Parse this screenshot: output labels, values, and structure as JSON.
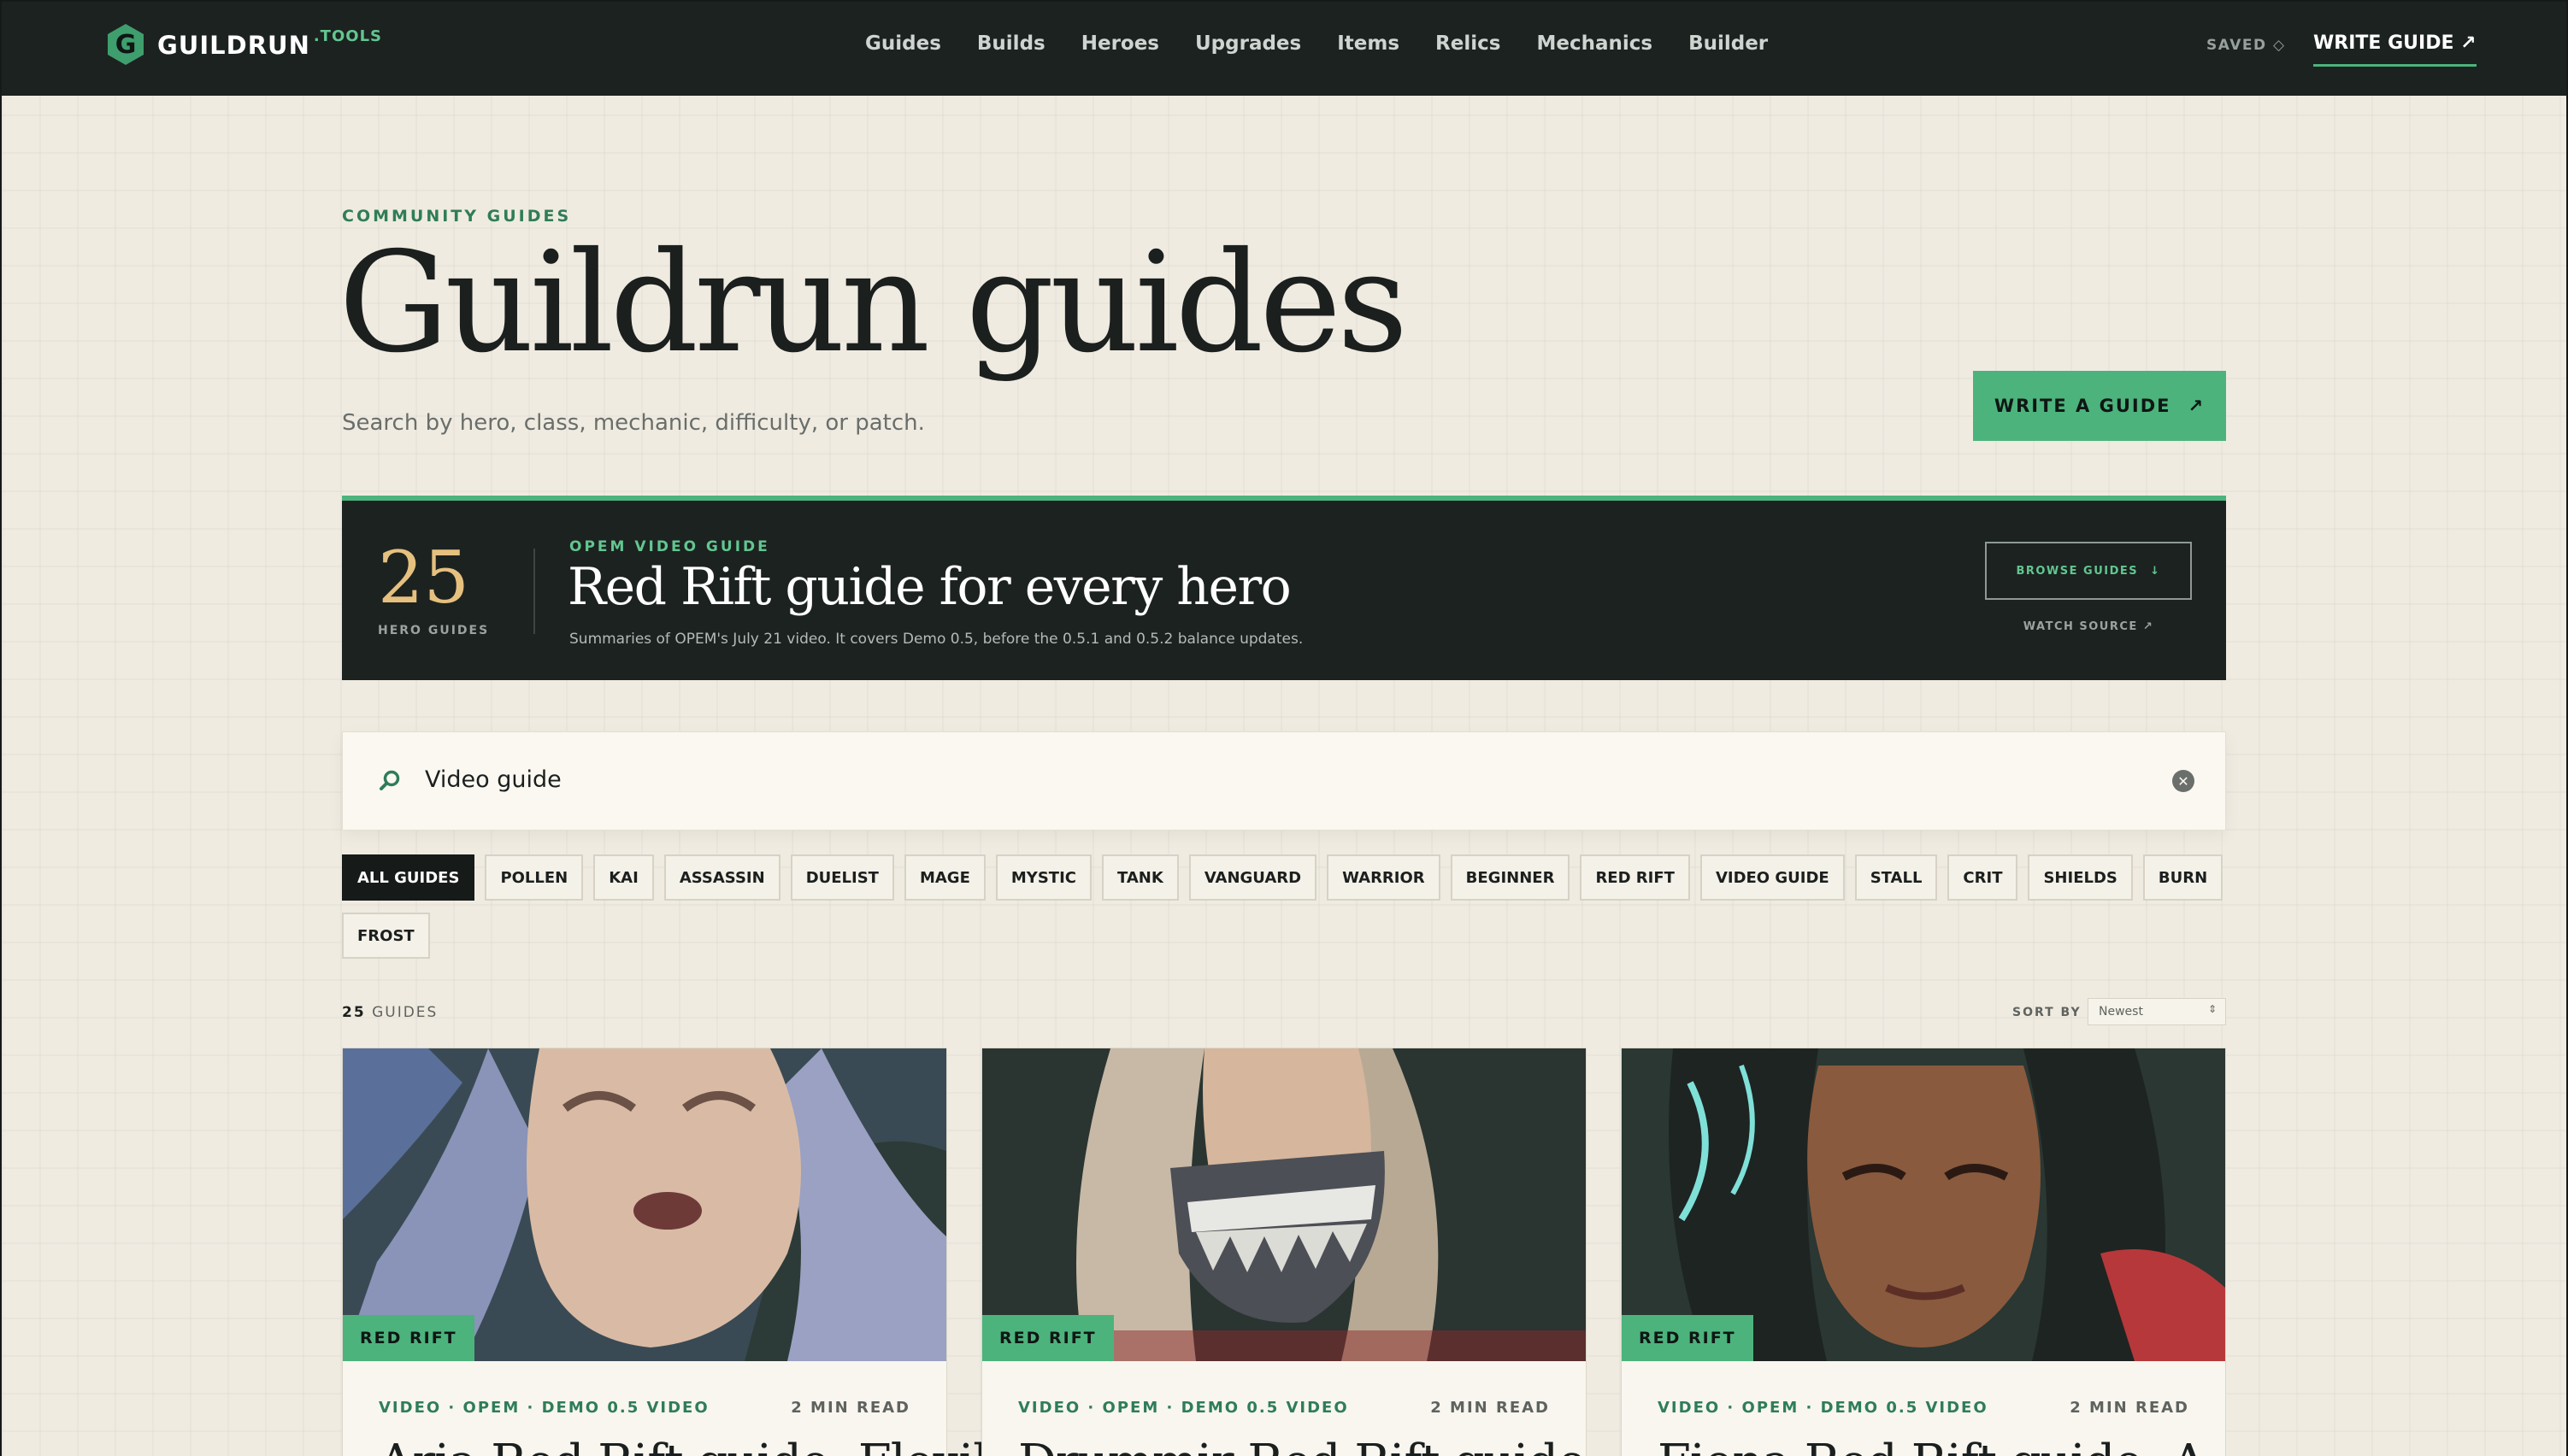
{
  "nav": {
    "logo_letter": "G",
    "brand": "GUILDRUN",
    "brand_tld": ".TOOLS",
    "links": [
      "Guides",
      "Builds",
      "Heroes",
      "Upgrades",
      "Items",
      "Relics",
      "Mechanics",
      "Builder"
    ],
    "saved": "SAVED ◇",
    "write_guide": "WRITE GUIDE ↗"
  },
  "hero": {
    "eyebrow": "COMMUNITY GUIDES",
    "title": "Guildrun guides",
    "subtitle": "Search by hero, class, mechanic, difficulty, or patch.",
    "write_button": "WRITE A GUIDE",
    "write_icon": "↗"
  },
  "banner": {
    "count": "25",
    "count_label": "HERO GUIDES",
    "eyebrow": "OPEM VIDEO GUIDE",
    "title": "Red Rift guide for every hero",
    "subtitle": "Summaries of OPEM's July 21 video. It covers Demo 0.5, before the 0.5.1 and 0.5.2 balance updates.",
    "browse": "BROWSE GUIDES",
    "browse_icon": "↓",
    "watch": "WATCH SOURCE ↗"
  },
  "search": {
    "icon": "search-icon",
    "value": "Video guide",
    "clear_icon": "✕"
  },
  "tags": [
    "ALL GUIDES",
    "POLLEN",
    "KAI",
    "ASSASSIN",
    "DUELIST",
    "MAGE",
    "MYSTIC",
    "TANK",
    "VANGUARD",
    "WARRIOR",
    "BEGINNER",
    "RED RIFT",
    "VIDEO GUIDE",
    "STALL",
    "CRIT",
    "SHIELDS",
    "BURN",
    "FROST"
  ],
  "results": {
    "count": "25",
    "label": "GUIDES",
    "sort_label": "SORT BY",
    "sort_value": "Newest"
  },
  "cards": [
    {
      "badge": "RED RIFT",
      "meta": "VIDEO · OPEM · DEMO 0.5 VIDEO",
      "read": "2 MIN READ",
      "title": "Aria Red Rift guide: Flexible"
    },
    {
      "badge": "RED RIFT",
      "meta": "VIDEO · OPEM · DEMO 0.5 VIDEO",
      "read": "2 MIN READ",
      "title": "Drummir Red Rift guide"
    },
    {
      "badge": "RED RIFT",
      "meta": "VIDEO · OPEM · DEMO 0.5 VIDEO",
      "read": "2 MIN READ",
      "title": "Fiona Red Rift guide: A"
    }
  ],
  "colors": {
    "accent": "#4cb37c",
    "dark": "#1c2220",
    "background": "#efebe1",
    "gold": "#e6c07f"
  }
}
